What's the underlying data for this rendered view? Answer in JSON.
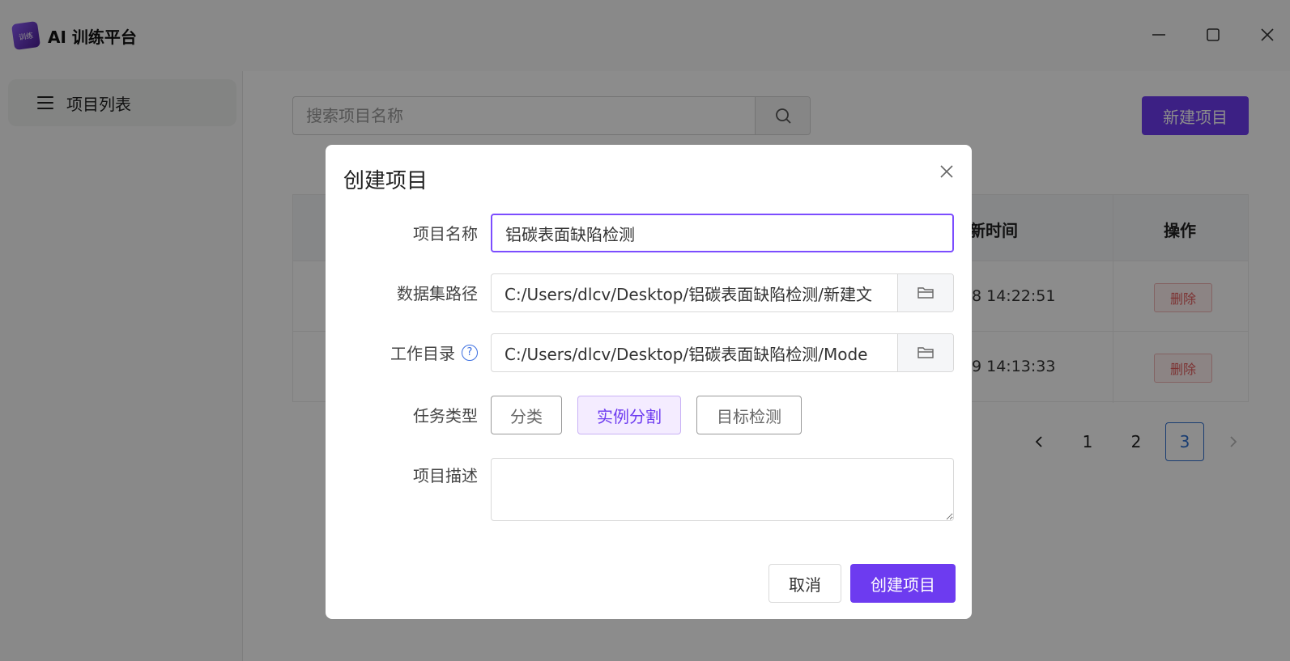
{
  "app": {
    "logo_text": "训练",
    "title": "AI 训练平台"
  },
  "window_controls": {
    "minimize_icon": "minimize-icon",
    "maximize_icon": "maximize-icon",
    "close_icon": "close-icon"
  },
  "sidebar": {
    "items": [
      {
        "label": "项目列表",
        "icon": "menu-icon"
      }
    ]
  },
  "search": {
    "placeholder": "搜索项目名称",
    "value": ""
  },
  "toolbar": {
    "new_project_label": "新建项目"
  },
  "table": {
    "headers": {
      "time": "新时间",
      "action": "操作"
    },
    "rows": [
      {
        "time": "8 14:22:51",
        "action": "删除"
      },
      {
        "time": "9 14:13:33",
        "action": "删除"
      }
    ]
  },
  "pagination": {
    "prev": "<",
    "pages": [
      "1",
      "2",
      "3"
    ],
    "current": "3",
    "next": ">"
  },
  "modal": {
    "title": "创建项目",
    "fields": {
      "name": {
        "label": "项目名称",
        "value": "铝碳表面缺陷检测"
      },
      "dataset": {
        "label": "数据集路径",
        "value": "C:/Users/dlcv/Desktop/铝碳表面缺陷检测/新建文"
      },
      "workdir": {
        "label": "工作目录",
        "value": "C:/Users/dlcv/Desktop/铝碳表面缺陷检测/Mode",
        "help": "?"
      },
      "task_type": {
        "label": "任务类型",
        "options": [
          "分类",
          "实例分割",
          "目标检测"
        ],
        "selected": "实例分割"
      },
      "description": {
        "label": "项目描述",
        "value": ""
      }
    },
    "cancel_label": "取消",
    "submit_label": "创建项目"
  },
  "colors": {
    "accent": "#6d3bf0",
    "danger": "#e35c5c",
    "link": "#2f6fd0"
  }
}
